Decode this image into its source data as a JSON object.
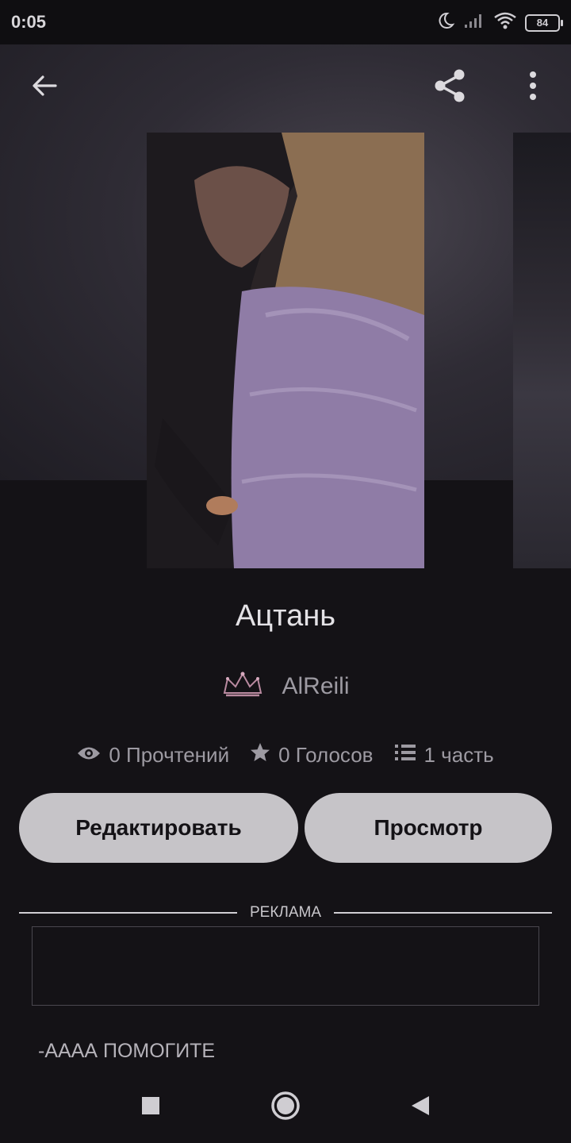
{
  "status_bar": {
    "time": "0:05",
    "battery": "84"
  },
  "toolbar": {
    "back_icon": "arrow-left-icon",
    "share_icon": "share-icon",
    "menu_icon": "more-vertical-icon"
  },
  "story": {
    "title": "Ацтань",
    "author": "AlReili",
    "reads": "0 Прочтений",
    "votes": "0 Голосов",
    "parts": "1 часть"
  },
  "actions": {
    "edit_label": "Редактировать",
    "view_label": "Просмотр"
  },
  "ad": {
    "label": "РЕКЛАМА"
  },
  "description": "-АААА ПОМОГИТЕ",
  "colors": {
    "background": "#141216",
    "button": "#c6c4c8",
    "text_secondary": "#9d9aa2"
  }
}
